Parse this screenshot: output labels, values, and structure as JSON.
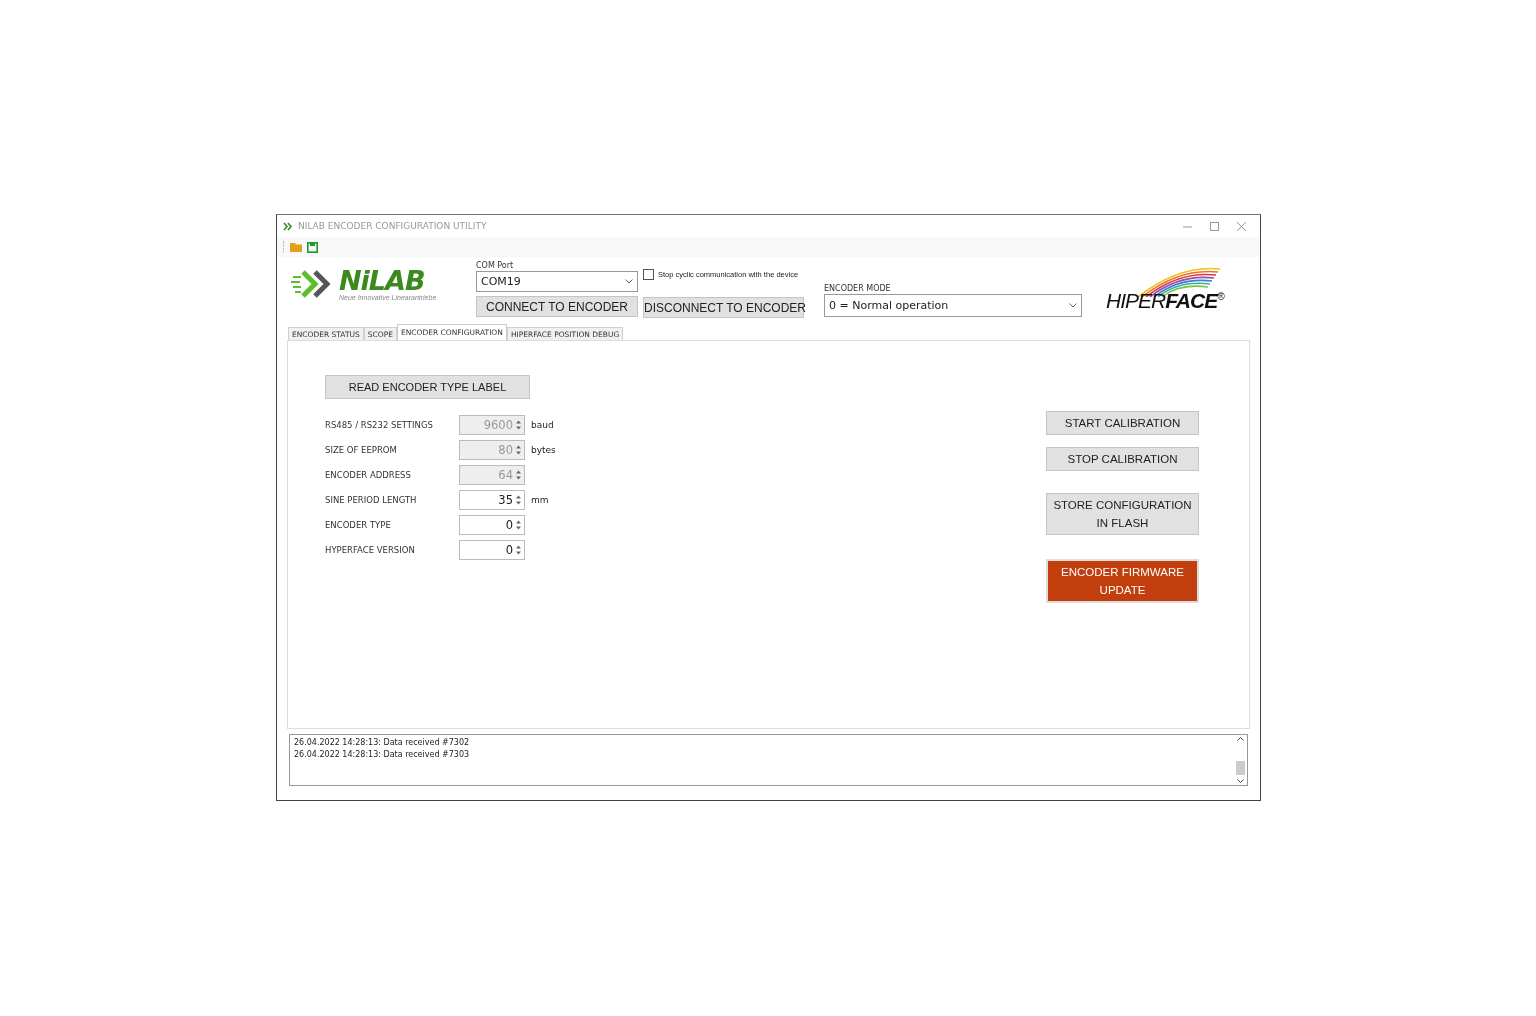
{
  "window": {
    "title": "NILAB ENCODER CONFIGURATION UTILITY"
  },
  "logo": {
    "name": "NiLAB",
    "tagline": "Neue Innovative Linearantriebe"
  },
  "com_port": {
    "label": "COM Port",
    "value": "COM19"
  },
  "stop_cyclic": {
    "label": "Stop cyclic communication with the device",
    "checked": false
  },
  "connection_buttons": [
    "CONNECT TO ENCODER",
    "DISCONNECT TO ENCODER"
  ],
  "encoder_mode": {
    "label": "ENCODER MODE",
    "value": "0 = Normal operation"
  },
  "brand": {
    "text": "HIPER**FACE**$^{®}$"
  },
  "tabs": [
    {
      "label": "ENCODER STATUS",
      "selected": false
    },
    {
      "label": "SCOPE",
      "selected": false
    },
    {
      "label": "ENCODER CONFIGURATION",
      "selected": true
    },
    {
      "label": "HIPERFACE POSITION DEBUG",
      "selected": false
    }
  ],
  "read_button": "READ ENCODER TYPE LABEL",
  "settings": [
    {
      "label": "RS485 / RS232 SETTINGS",
      "value": "9600",
      "unit": "baud",
      "disabled": true
    },
    {
      "label": "SIZE OF EEPROM",
      "value": "80",
      "unit": "bytes",
      "disabled": true
    },
    {
      "label": "ENCODER ADDRESS",
      "value": "64",
      "disabled": true
    },
    {
      "label": "SINE PERIOD LENGTH",
      "value": "35",
      "unit": "mm",
      "disabled": false
    },
    {
      "label": "ENCODER TYPE",
      "value": "0",
      "disabled": false
    },
    {
      "label": "HYPERFACE VERSION",
      "value": "0",
      "disabled": false
    }
  ],
  "actions": [
    {
      "label": "START CALIBRATION",
      "kind": "normal"
    },
    {
      "label": "STOP CALIBRATION",
      "kind": "normal"
    },
    {
      "label": "STORE CONFIGURATION IN FLASH",
      "kind": "normal"
    },
    {
      "label": "ENCODER FIRMWARE UPDATE",
      "kind": "accent"
    }
  ],
  "log": [
    "26.04.2022 14:28:13: Data received #7302",
    "26.04.2022 14:28:13: Data received #7303"
  ]
}
